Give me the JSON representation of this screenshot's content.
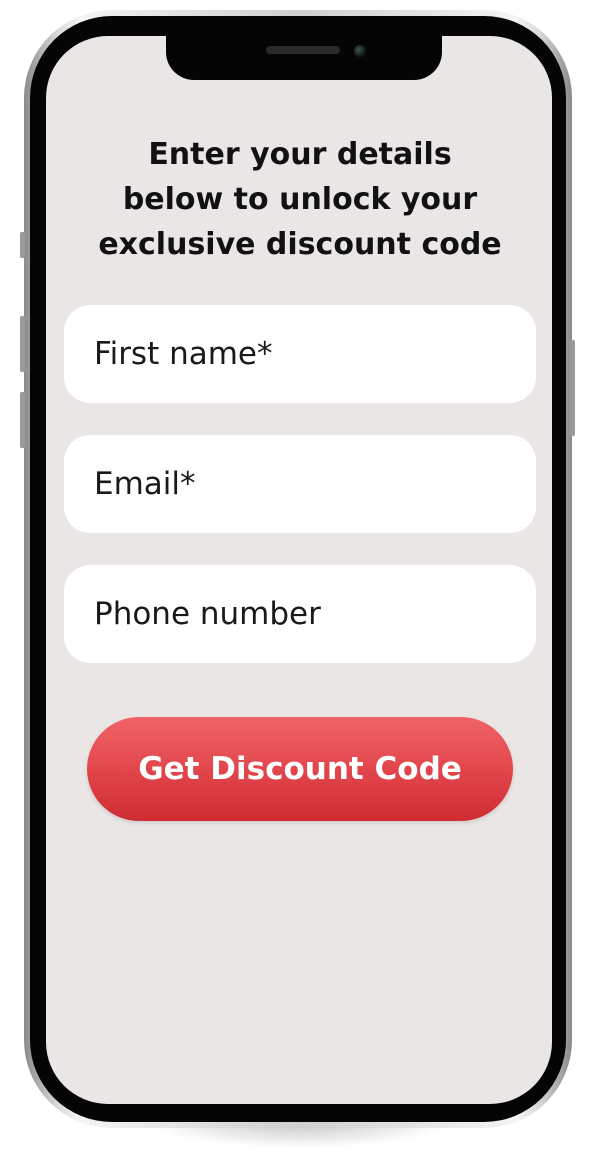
{
  "form": {
    "headline_line1": "Enter your details",
    "headline_line2": "below to unlock your",
    "headline_line3": "exclusive discount code",
    "first_name_placeholder": "First name*",
    "email_placeholder": "Email*",
    "phone_placeholder": "Phone number",
    "submit_label": "Get Discount Code"
  },
  "colors": {
    "screen_background": "#ebe6e6",
    "button_accent": "#e2464c",
    "field_background": "#ffffff"
  }
}
